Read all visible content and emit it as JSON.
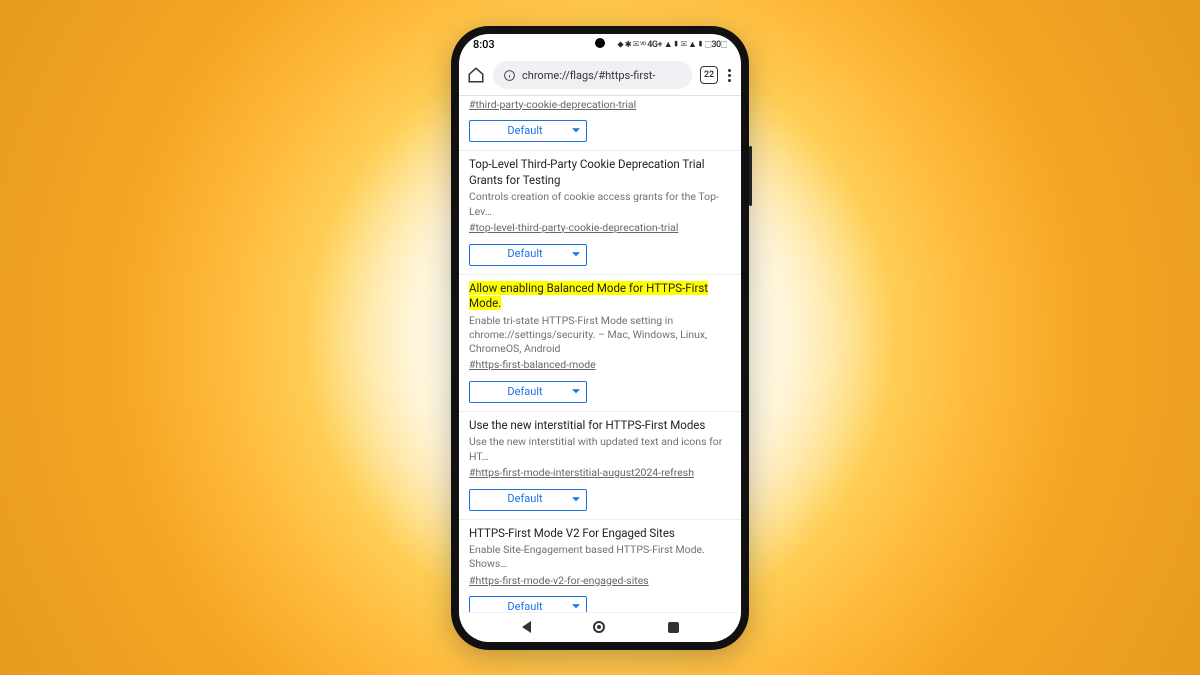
{
  "statusbar": {
    "time": "8:03",
    "icons": "⬥ ✱ ✉ ᵛᵒ 4G+ ▲▮ ✉ ▲▮ ⬚30⬚"
  },
  "omnibar": {
    "url": "chrome://flags/#https-first-",
    "tab_count": "22"
  },
  "flags": [
    {
      "title": "",
      "desc": "",
      "anchor": "#third-party-cookie-deprecation-trial",
      "select": "Default",
      "highlighted": false
    },
    {
      "title": "Top-Level Third-Party Cookie Deprecation Trial Grants for Testing",
      "desc": "Controls creation of cookie access grants for the Top-Lev…",
      "anchor": "#top-level-third-party-cookie-deprecation-trial",
      "select": "Default",
      "highlighted": false
    },
    {
      "title": "Allow enabling Balanced Mode for HTTPS-First Mode.",
      "desc": "Enable tri-state HTTPS-First Mode setting in chrome://settings/security. – Mac, Windows, Linux, ChromeOS, Android",
      "anchor": "#https-first-balanced-mode",
      "select": "Default",
      "highlighted": true
    },
    {
      "title": "Use the new interstitial for HTTPS-First Modes",
      "desc": "Use the new interstitial with updated text and icons for HT…",
      "anchor": "#https-first-mode-interstitial-august2024-refresh",
      "select": "Default",
      "highlighted": false
    },
    {
      "title": "HTTPS-First Mode V2 For Engaged Sites",
      "desc": "Enable Site-Engagement based HTTPS-First Mode. Shows…",
      "anchor": "#https-first-mode-v2-for-engaged-sites",
      "select": "Default",
      "highlighted": false
    }
  ]
}
